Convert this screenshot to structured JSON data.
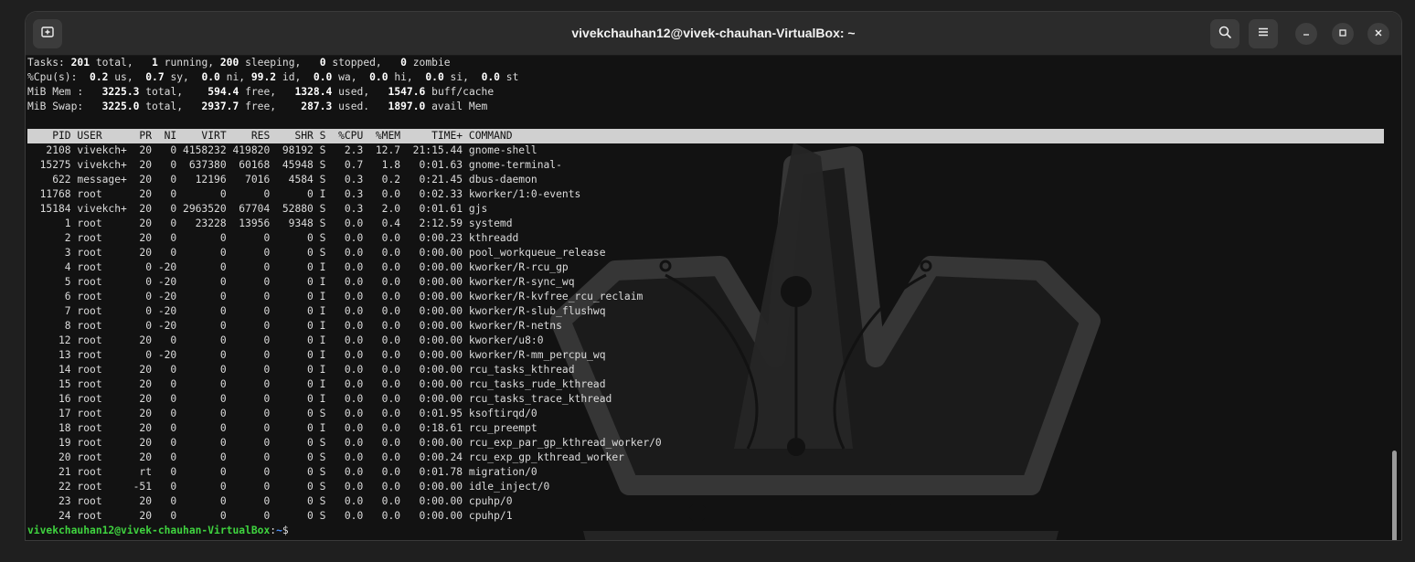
{
  "window": {
    "title": "vivekchauhan12@vivek-chauhan-VirtualBox: ~"
  },
  "icons": {
    "new_tab": "new-tab-icon",
    "search": "search-icon",
    "menu": "hamburger-menu-icon",
    "minimize": "minimize-icon",
    "maximize": "maximize-icon",
    "close": "close-icon",
    "wallpaper": "crown-watermark"
  },
  "summary": {
    "tasks": {
      "label": "Tasks:",
      "total": "201",
      "total_label": " total,   ",
      "running": "1",
      "running_label": " running, ",
      "sleeping": "200",
      "sleeping_label": " sleeping,   ",
      "stopped": "0",
      "stopped_label": " stopped,   ",
      "zombie": "0",
      "zombie_label": " zombie"
    },
    "cpu": {
      "label": "%Cpu(s):  ",
      "us": "0.2",
      "us_label": " us,  ",
      "sy": "0.7",
      "sy_label": " sy,  ",
      "ni": "0.0",
      "ni_label": " ni, ",
      "id": "99.2",
      "id_label": " id,  ",
      "wa": "0.0",
      "wa_label": " wa,  ",
      "hi": "0.0",
      "hi_label": " hi,  ",
      "si": "0.0",
      "si_label": " si,  ",
      "st": "0.0",
      "st_label": " st"
    },
    "mem": {
      "label": "MiB Mem :   ",
      "total": "3225.3",
      "total_label": " total,    ",
      "free": "594.4",
      "free_label": " free,   ",
      "used": "1328.4",
      "used_label": " used,   ",
      "cache": "1547.6",
      "cache_label": " buff/cache"
    },
    "swap": {
      "label": "MiB Swap:   ",
      "total": "3225.0",
      "total_label": " total,   ",
      "free": "2937.7",
      "free_label": " free,    ",
      "used": "287.3",
      "used_label": " used.   ",
      "avail": "1897.0",
      "avail_label": " avail Mem"
    }
  },
  "process_table": {
    "header": "    PID USER      PR  NI    VIRT    RES    SHR S  %CPU  %MEM     TIME+ COMMAND",
    "rows": [
      "   2108 vivekch+  20   0 4158232 419820  98192 S   2.3  12.7  21:15.44 gnome-shell",
      "  15275 vivekch+  20   0  637380  60168  45948 S   0.7   1.8   0:01.63 gnome-terminal-",
      "    622 message+  20   0   12196   7016   4584 S   0.3   0.2   0:21.45 dbus-daemon",
      "  11768 root      20   0       0      0      0 I   0.3   0.0   0:02.33 kworker/1:0-events",
      "  15184 vivekch+  20   0 2963520  67704  52880 S   0.3   2.0   0:01.61 gjs",
      "      1 root      20   0   23228  13956   9348 S   0.0   0.4   2:12.59 systemd",
      "      2 root      20   0       0      0      0 S   0.0   0.0   0:00.23 kthreadd",
      "      3 root      20   0       0      0      0 S   0.0   0.0   0:00.00 pool_workqueue_release",
      "      4 root       0 -20       0      0      0 I   0.0   0.0   0:00.00 kworker/R-rcu_gp",
      "      5 root       0 -20       0      0      0 I   0.0   0.0   0:00.00 kworker/R-sync_wq",
      "      6 root       0 -20       0      0      0 I   0.0   0.0   0:00.00 kworker/R-kvfree_rcu_reclaim",
      "      7 root       0 -20       0      0      0 I   0.0   0.0   0:00.00 kworker/R-slub_flushwq",
      "      8 root       0 -20       0      0      0 I   0.0   0.0   0:00.00 kworker/R-netns",
      "     12 root      20   0       0      0      0 I   0.0   0.0   0:00.00 kworker/u8:0",
      "     13 root       0 -20       0      0      0 I   0.0   0.0   0:00.00 kworker/R-mm_percpu_wq",
      "     14 root      20   0       0      0      0 I   0.0   0.0   0:00.00 rcu_tasks_kthread",
      "     15 root      20   0       0      0      0 I   0.0   0.0   0:00.00 rcu_tasks_rude_kthread",
      "     16 root      20   0       0      0      0 I   0.0   0.0   0:00.00 rcu_tasks_trace_kthread",
      "     17 root      20   0       0      0      0 S   0.0   0.0   0:01.95 ksoftirqd/0",
      "     18 root      20   0       0      0      0 I   0.0   0.0   0:18.61 rcu_preempt",
      "     19 root      20   0       0      0      0 S   0.0   0.0   0:00.00 rcu_exp_par_gp_kthread_worker/0",
      "     20 root      20   0       0      0      0 S   0.0   0.0   0:00.24 rcu_exp_gp_kthread_worker",
      "     21 root      rt   0       0      0      0 S   0.0   0.0   0:01.78 migration/0",
      "     22 root     -51   0       0      0      0 S   0.0   0.0   0:00.00 idle_inject/0",
      "     23 root      20   0       0      0      0 S   0.0   0.0   0:00.00 cpuhp/0",
      "     24 root      20   0       0      0      0 S   0.0   0.0   0:00.00 cpuhp/1"
    ]
  },
  "prompt": {
    "user_host": "vivekchauhan12@vivek-chauhan-VirtualBox",
    "separator": ":",
    "path": "~",
    "symbol": "$"
  }
}
